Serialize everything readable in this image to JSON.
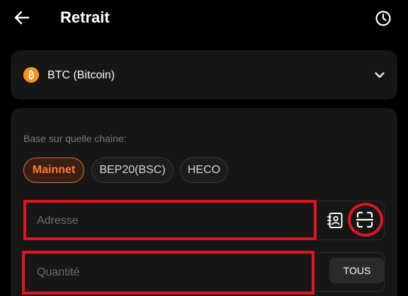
{
  "header": {
    "title": "Retrait",
    "back_icon": "arrow-left-icon",
    "history_icon": "clock-icon"
  },
  "coin": {
    "label": "BTC (Bitcoin)",
    "icon": "bitcoin-icon",
    "icon_color": "#f7931a",
    "chevron_icon": "chevron-down-icon"
  },
  "chain": {
    "caption": "Base sur quelle chaine:",
    "options": [
      "Mainnet",
      "BEP20(BSC)",
      "HECO"
    ],
    "selected": "Mainnet",
    "accent_color": "#ff7a3d"
  },
  "address": {
    "placeholder": "Adresse",
    "contacts_icon": "address-book-icon",
    "scan_icon": "scan-qr-icon"
  },
  "quantity": {
    "placeholder": "Quantité",
    "all_label": "TOUS"
  },
  "highlight_color": "#e3141e"
}
